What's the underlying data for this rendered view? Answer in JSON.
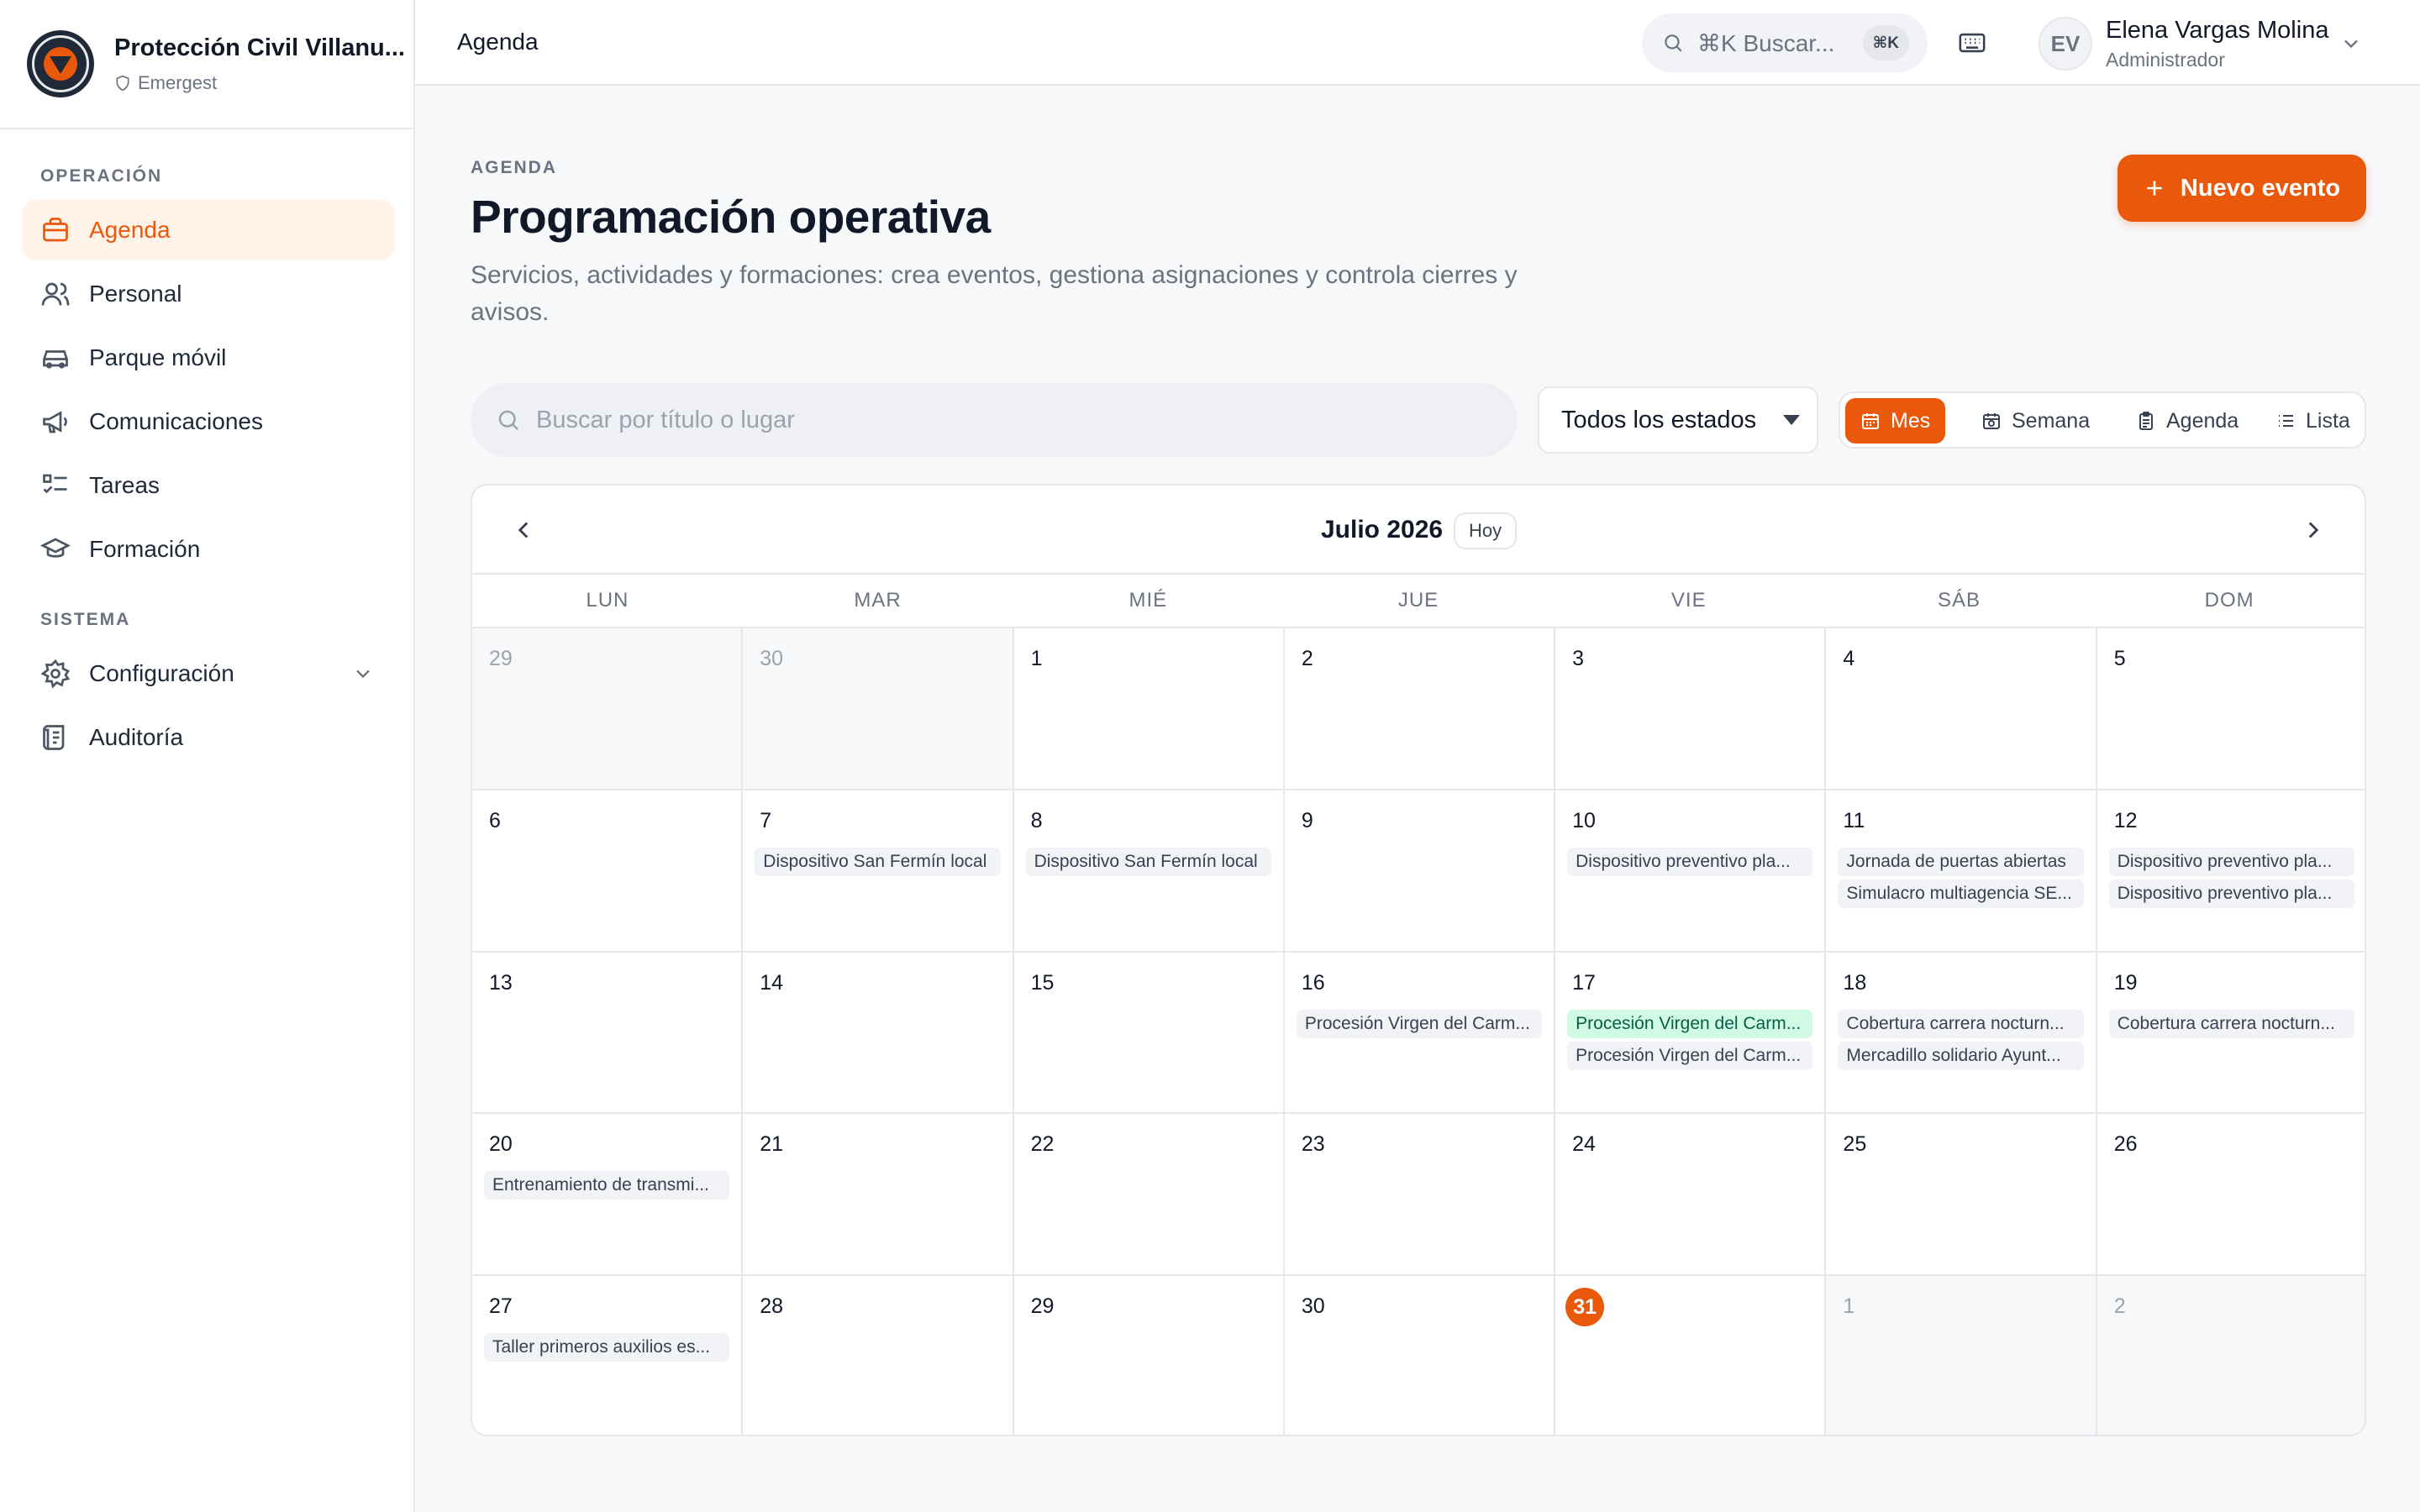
{
  "brand": {
    "title": "Protección Civil Villanu...",
    "subtitle": "Emergest"
  },
  "sidebar": {
    "sections": [
      {
        "label": "OPERACIÓN"
      },
      {
        "label": "SISTEMA"
      }
    ],
    "items": [
      {
        "label": "Agenda",
        "icon": "briefcase-icon",
        "active": true
      },
      {
        "label": "Personal",
        "icon": "users-icon"
      },
      {
        "label": "Parque móvil",
        "icon": "car-icon"
      },
      {
        "label": "Comunicaciones",
        "icon": "megaphone-icon"
      },
      {
        "label": "Tareas",
        "icon": "checklist-icon"
      },
      {
        "label": "Formación",
        "icon": "graduation-cap-icon"
      },
      {
        "label": "Configuración",
        "icon": "gear-icon"
      },
      {
        "label": "Auditoría",
        "icon": "scroll-icon"
      }
    ]
  },
  "topbar": {
    "title": "Agenda",
    "search_placeholder": "⌘K Buscar...",
    "search_kbd": "⌘K",
    "user": {
      "initials": "EV",
      "name": "Elena Vargas Molina",
      "role": "Administrador"
    }
  },
  "header": {
    "eyebrow": "AGENDA",
    "title": "Programación operativa",
    "description": "Servicios, actividades y formaciones: crea eventos, gestiona asignaciones y controla cierres y avisos.",
    "new_button": "Nuevo evento"
  },
  "filters": {
    "search_placeholder": "Buscar por título o lugar",
    "status_select": "Todos los estados",
    "views": [
      "Mes",
      "Semana",
      "Agenda",
      "Lista"
    ],
    "active_view": "Mes"
  },
  "calendar": {
    "month_label": "Julio 2026",
    "today_button": "Hoy",
    "weekdays": [
      "LUN",
      "MAR",
      "MIÉ",
      "JUE",
      "VIE",
      "SÁB",
      "DOM"
    ],
    "weeks": [
      [
        {
          "day": "29",
          "out": true,
          "events": []
        },
        {
          "day": "30",
          "out": true,
          "events": []
        },
        {
          "day": "1",
          "events": []
        },
        {
          "day": "2",
          "events": []
        },
        {
          "day": "3",
          "events": []
        },
        {
          "day": "4",
          "events": []
        },
        {
          "day": "5",
          "events": []
        }
      ],
      [
        {
          "day": "6",
          "events": []
        },
        {
          "day": "7",
          "events": [
            {
              "title": "Dispositivo San Fermín local"
            }
          ]
        },
        {
          "day": "8",
          "events": [
            {
              "title": "Dispositivo San Fermín local"
            }
          ]
        },
        {
          "day": "9",
          "events": []
        },
        {
          "day": "10",
          "events": [
            {
              "title": "Dispositivo preventivo pla..."
            }
          ]
        },
        {
          "day": "11",
          "events": [
            {
              "title": "Jornada de puertas abiertas"
            },
            {
              "title": "Simulacro multiagencia SE..."
            }
          ]
        },
        {
          "day": "12",
          "events": [
            {
              "title": "Dispositivo preventivo pla..."
            },
            {
              "title": "Dispositivo preventivo pla..."
            }
          ]
        }
      ],
      [
        {
          "day": "13",
          "events": []
        },
        {
          "day": "14",
          "events": []
        },
        {
          "day": "15",
          "events": []
        },
        {
          "day": "16",
          "events": [
            {
              "title": "Procesión Virgen del Carm..."
            }
          ]
        },
        {
          "day": "17",
          "events": [
            {
              "title": "Procesión Virgen del Carm...",
              "color": "green"
            },
            {
              "title": "Procesión Virgen del Carm..."
            }
          ]
        },
        {
          "day": "18",
          "events": [
            {
              "title": "Cobertura carrera nocturn..."
            },
            {
              "title": "Mercadillo solidario Ayunt..."
            }
          ]
        },
        {
          "day": "19",
          "events": [
            {
              "title": "Cobertura carrera nocturn..."
            }
          ]
        }
      ],
      [
        {
          "day": "20",
          "events": [
            {
              "title": "Entrenamiento de transmi..."
            }
          ]
        },
        {
          "day": "21",
          "events": []
        },
        {
          "day": "22",
          "events": []
        },
        {
          "day": "23",
          "events": []
        },
        {
          "day": "24",
          "events": []
        },
        {
          "day": "25",
          "events": []
        },
        {
          "day": "26",
          "events": []
        }
      ],
      [
        {
          "day": "27",
          "events": [
            {
              "title": "Taller primeros auxilios es..."
            }
          ]
        },
        {
          "day": "28",
          "events": []
        },
        {
          "day": "29",
          "events": []
        },
        {
          "day": "30",
          "events": []
        },
        {
          "day": "31",
          "today": true,
          "events": []
        },
        {
          "day": "1",
          "out": true,
          "events": []
        },
        {
          "day": "2",
          "out": true,
          "events": []
        }
      ]
    ]
  },
  "colors": {
    "accent": "#ea580c",
    "accent_soft": "#fff3ea",
    "event_bg": "#f1f3f6",
    "event_green": "#d1fae5"
  }
}
